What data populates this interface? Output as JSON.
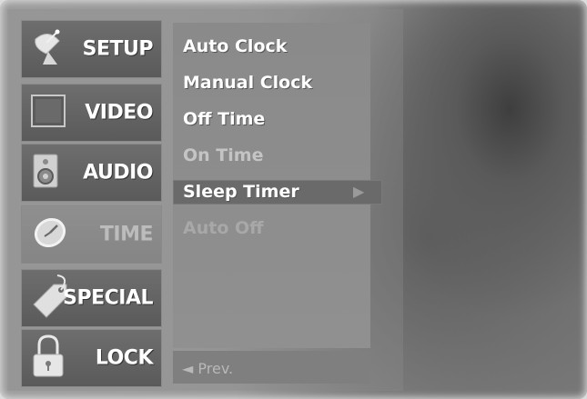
{
  "categories": [
    {
      "label": "SETUP",
      "icon": "satellite-dish-icon"
    },
    {
      "label": "VIDEO",
      "icon": "tv-screen-icon"
    },
    {
      "label": "AUDIO",
      "icon": "speaker-icon"
    },
    {
      "label": "TIME",
      "icon": "clock-icon",
      "selected": true
    },
    {
      "label": "SPECIAL",
      "icon": "tag-icon"
    },
    {
      "label": "LOCK",
      "icon": "padlock-icon"
    }
  ],
  "submenu": {
    "items": [
      {
        "label": "Auto Clock"
      },
      {
        "label": "Manual Clock"
      },
      {
        "label": "Off Time"
      },
      {
        "label": "On Time"
      },
      {
        "label": "Sleep Timer",
        "highlighted": true,
        "has_submenu": true
      },
      {
        "label": "Auto Off",
        "disabled": true
      }
    ],
    "submenu_arrow": "▶",
    "prev_label": "◄ Prev."
  }
}
